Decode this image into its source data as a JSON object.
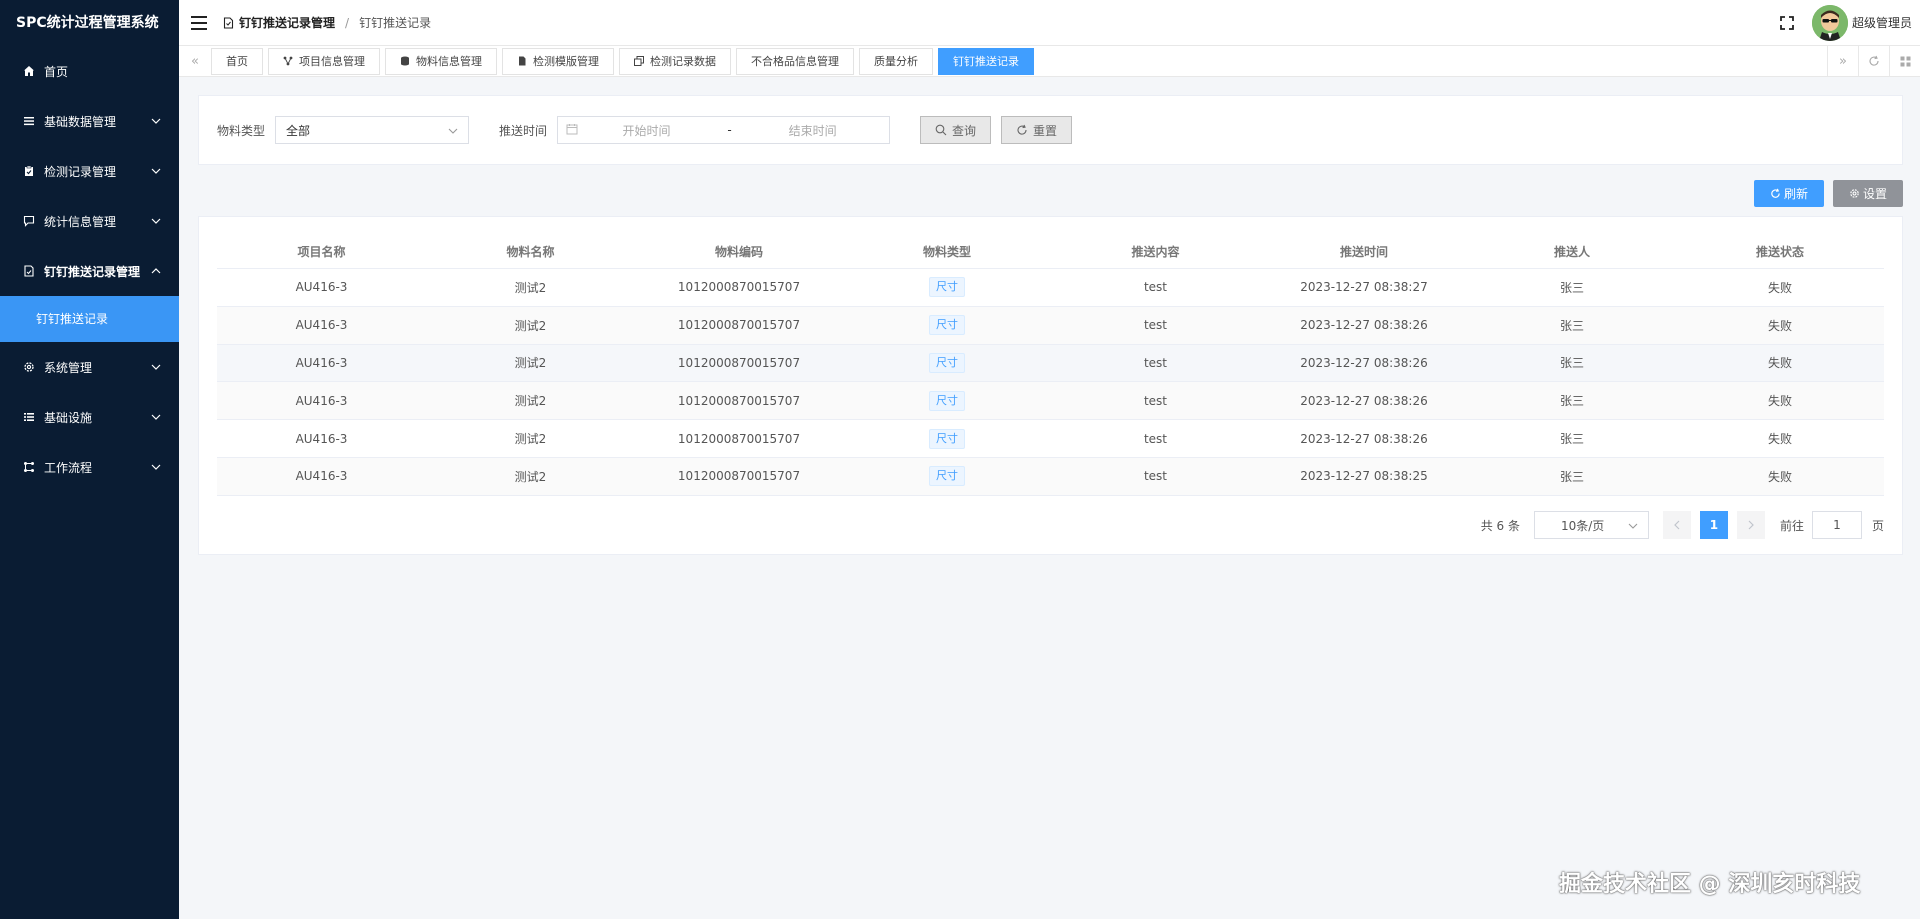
{
  "app": {
    "title": "SPC统计过程管理系统"
  },
  "sidebar": {
    "items": [
      {
        "label": "首页",
        "icon": "home-icon"
      },
      {
        "label": "基础数据管理",
        "icon": "list-icon"
      },
      {
        "label": "检测记录管理",
        "icon": "clipboard-icon"
      },
      {
        "label": "统计信息管理",
        "icon": "chat-icon"
      },
      {
        "label": "钉钉推送记录管理",
        "icon": "document-icon"
      },
      {
        "label": "系统管理",
        "icon": "gear-icon"
      },
      {
        "label": "基础设施",
        "icon": "list-icon"
      },
      {
        "label": "工作流程",
        "icon": "flow-icon"
      }
    ],
    "submenu": {
      "label": "钉钉推送记录"
    }
  },
  "header": {
    "breadcrumb": [
      "钉钉推送记录管理",
      "/",
      "钉钉推送记录"
    ],
    "username": "超级管理员"
  },
  "tabs": [
    {
      "label": "首页"
    },
    {
      "label": "项目信息管理"
    },
    {
      "label": "物料信息管理"
    },
    {
      "label": "检测模版管理"
    },
    {
      "label": "检测记录数据"
    },
    {
      "label": "不合格品信息管理"
    },
    {
      "label": "质量分析"
    },
    {
      "label": "钉钉推送记录"
    }
  ],
  "search": {
    "material_type_label": "物料类型",
    "material_type_value": "全部",
    "push_time_label": "推送时间",
    "start_placeholder": "开始时间",
    "range_separator": "-",
    "end_placeholder": "结束时间",
    "query_label": "查询",
    "reset_label": "重置"
  },
  "toolbar": {
    "refresh_label": "刷新",
    "settings_label": "设置"
  },
  "table": {
    "headers": [
      "项目名称",
      "物料名称",
      "物料编码",
      "物料类型",
      "推送内容",
      "推送时间",
      "推送人",
      "推送状态"
    ],
    "rows": [
      [
        "AU416-3",
        "测试2",
        "1012000870015707",
        "尺寸",
        "test",
        "2023-12-27 08:38:27",
        "张三",
        "失败"
      ],
      [
        "AU416-3",
        "测试2",
        "1012000870015707",
        "尺寸",
        "test",
        "2023-12-27 08:38:26",
        "张三",
        "失败"
      ],
      [
        "AU416-3",
        "测试2",
        "1012000870015707",
        "尺寸",
        "test",
        "2023-12-27 08:38:26",
        "张三",
        "失败"
      ],
      [
        "AU416-3",
        "测试2",
        "1012000870015707",
        "尺寸",
        "test",
        "2023-12-27 08:38:26",
        "张三",
        "失败"
      ],
      [
        "AU416-3",
        "测试2",
        "1012000870015707",
        "尺寸",
        "test",
        "2023-12-27 08:38:26",
        "张三",
        "失败"
      ],
      [
        "AU416-3",
        "测试2",
        "1012000870015707",
        "尺寸",
        "test",
        "2023-12-27 08:38:25",
        "张三",
        "失败"
      ]
    ]
  },
  "pagination": {
    "total_text": "共 6 条",
    "page_size": "10条/页",
    "current_page": "1",
    "goto_label": "前往",
    "goto_value": "1",
    "page_suffix": "页"
  },
  "watermark": "掘金技术社区 @ 深圳亥时科技",
  "colors": {
    "sidebar_bg": "#0a1c33",
    "accent": "#409eff",
    "settings_btn": "#909399"
  }
}
